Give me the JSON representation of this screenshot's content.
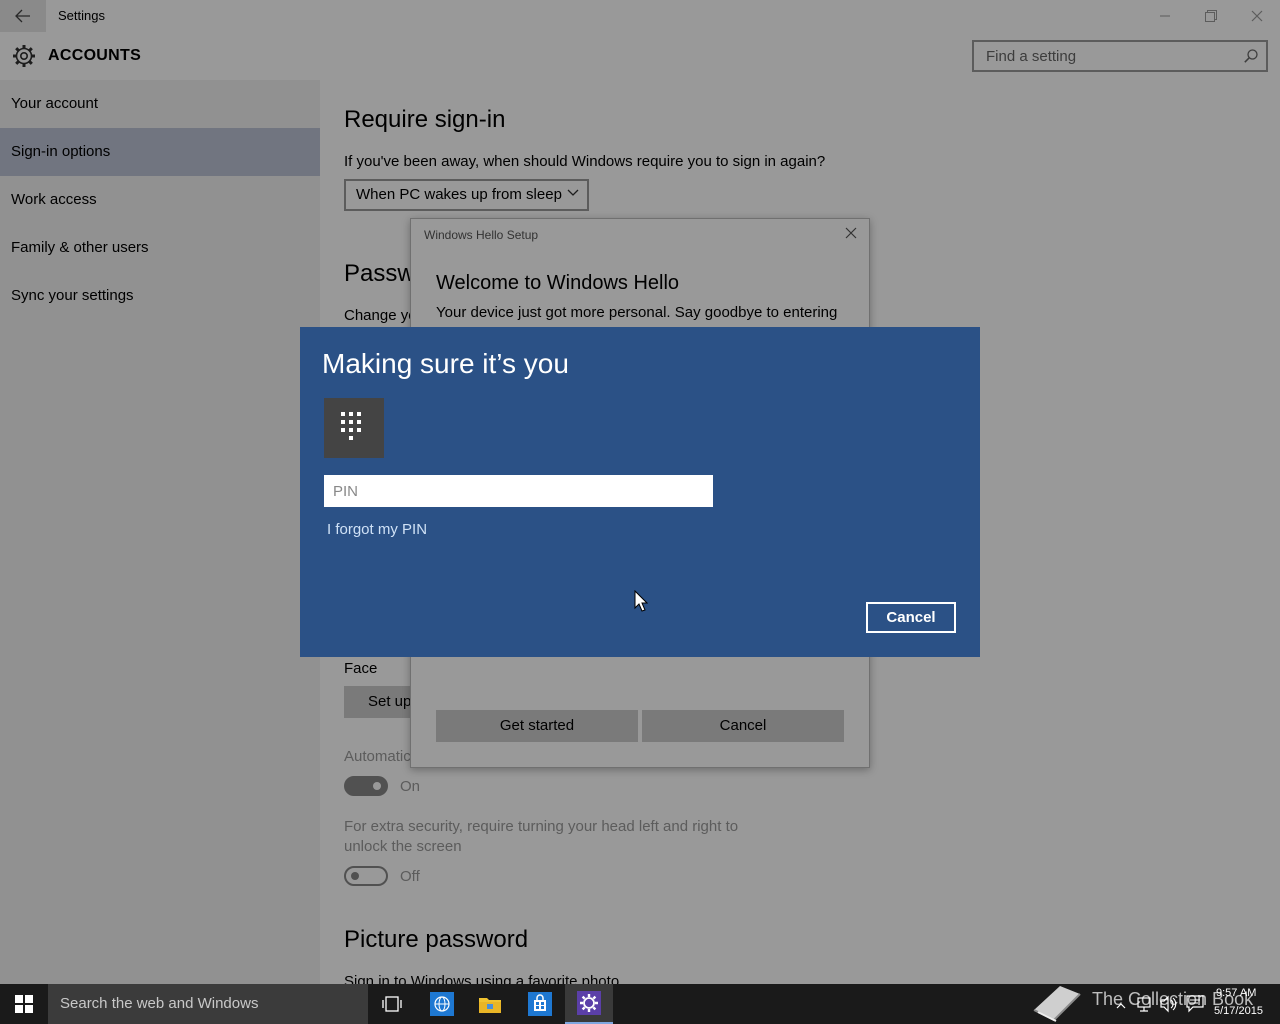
{
  "window": {
    "title": "Settings"
  },
  "header": {
    "section_title": "ACCOUNTS",
    "search_placeholder": "Find a setting"
  },
  "sidebar": {
    "items": [
      {
        "label": "Your account"
      },
      {
        "label": "Sign-in options",
        "selected": true
      },
      {
        "label": "Work access"
      },
      {
        "label": "Family & other users"
      },
      {
        "label": "Sync your settings"
      }
    ]
  },
  "main": {
    "require_signin": {
      "heading": "Require sign-in",
      "description": "If you've been away, when should Windows require you to sign in again?",
      "dropdown_value": "When PC wakes up from sleep"
    },
    "password": {
      "heading_partial": "Passwo",
      "text_partial": "Change yo"
    },
    "face": {
      "label": "Face",
      "setup_button_partial": "Set up"
    },
    "auto": {
      "label_partial": "Automatic",
      "toggle_state": "On"
    },
    "extra_security": {
      "line1": "For extra security, require turning your head left and right to",
      "line2": "unlock the screen",
      "toggle_state": "Off"
    },
    "picture_password": {
      "heading": "Picture password",
      "text_partial": "Sign in to Windows using a favorite photo"
    }
  },
  "hello_dialog": {
    "title": "Windows Hello Setup",
    "heading": "Welcome to Windows Hello",
    "text": "Your device just got more personal. Say goodbye to entering",
    "get_started_label": "Get started",
    "cancel_label": "Cancel"
  },
  "pin_dialog": {
    "title": "Making sure it’s you",
    "pin_placeholder": "PIN",
    "forgot_link": "I forgot my PIN",
    "cancel_label": "Cancel",
    "keypad_icon": "keypad-icon"
  },
  "taskbar": {
    "search_placeholder": "Search the web and Windows",
    "watermark_text": "The Collection Book",
    "time": "9:57 AM",
    "date": "5/17/2015"
  },
  "colors": {
    "accent": "#2b5186",
    "selected_nav": "#bcc4d6",
    "link": "#cfe1f6"
  }
}
